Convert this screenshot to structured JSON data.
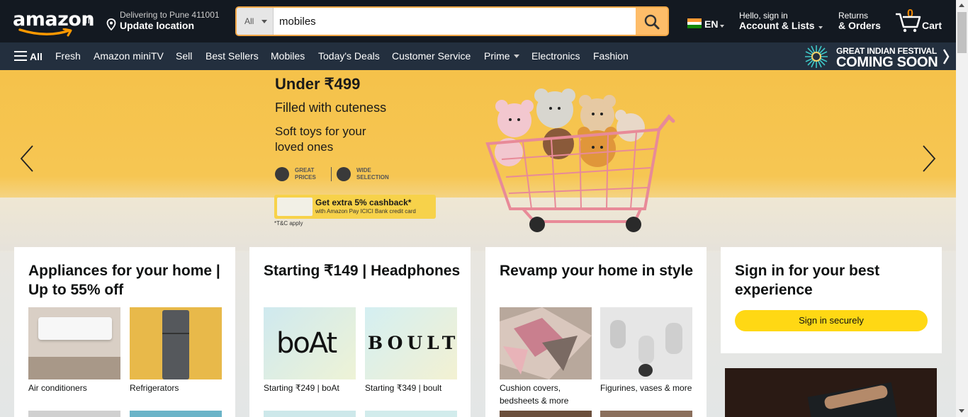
{
  "header": {
    "logo_text": "amazon",
    "logo_tld": ".in",
    "location_line1": "Delivering to Pune 411001",
    "location_line2": "Update location",
    "search_category": "All",
    "search_value": "mobiles",
    "language": "EN",
    "account_line1": "Hello, sign in",
    "account_line2": "Account & Lists",
    "orders_line1": "Returns",
    "orders_line2": "& Orders",
    "cart_count": "0",
    "cart_label": "Cart"
  },
  "subnav": {
    "all": "All",
    "items": [
      "Fresh",
      "Amazon miniTV",
      "Sell",
      "Best Sellers",
      "Mobiles",
      "Today's Deals",
      "Customer Service",
      "Prime",
      "Electronics",
      "Fashion"
    ],
    "festival_line1": "GREAT INDIAN FESTIVAL",
    "festival_line2": "COMING SOON"
  },
  "hero": {
    "title": "Under ₹499",
    "subtitle": "Filled with cuteness",
    "desc_line1": "Soft toys for your",
    "desc_line2": "loved ones",
    "badge1_line1": "GREAT",
    "badge1_line2": "PRICES",
    "badge2_line1": "WIDE",
    "badge2_line2": "SELECTION",
    "cashback_line1": "Get extra 5% cashback*",
    "cashback_line2": "with Amazon Pay ICICI Bank credit card",
    "tc": "*T&C apply"
  },
  "cards": [
    {
      "title": "Appliances for your home | Up to 55% off",
      "tiles": [
        {
          "caption": "Air conditioners"
        },
        {
          "caption": "Refrigerators"
        }
      ]
    },
    {
      "title": "Starting ₹149 | Headphones",
      "tiles": [
        {
          "caption": "Starting ₹249 | boAt",
          "brand": "boAt"
        },
        {
          "caption": "Starting ₹349 | boult",
          "brand": "BOULT"
        }
      ]
    },
    {
      "title": "Revamp your home in style",
      "tiles": [
        {
          "caption": "Cushion covers, bedsheets & more"
        },
        {
          "caption": "Figurines, vases & more"
        }
      ]
    }
  ],
  "signin_card": {
    "title": "Sign in for your best experience",
    "button": "Sign in securely"
  },
  "colors": {
    "header_bg": "#131921",
    "subnav_bg": "#232f3e",
    "search_button": "#febd69",
    "signin_button": "#ffd814",
    "cart_count": "#f08804"
  }
}
